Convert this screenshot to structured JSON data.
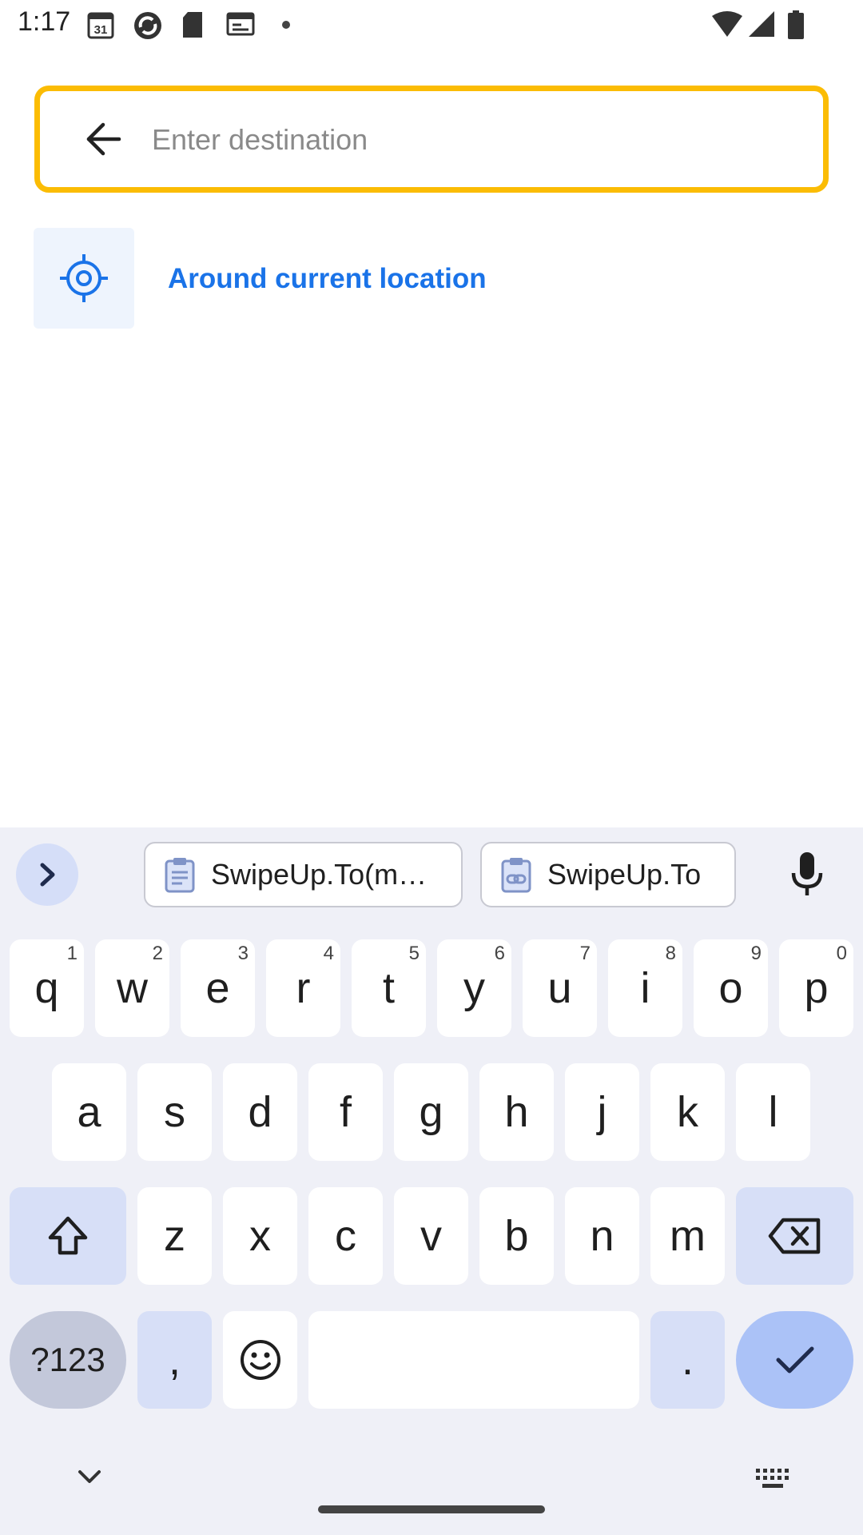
{
  "status_bar": {
    "time": "1:17",
    "icons": [
      "calendar-31-icon",
      "sync-icon",
      "sd-card-icon",
      "news-icon",
      "dot-icon",
      "wifi-icon",
      "signal-icon",
      "battery-icon"
    ],
    "calendar_day": "31"
  },
  "search": {
    "placeholder": "Enter destination",
    "value": "",
    "border_color": "#fbbc04"
  },
  "suggestions": [
    {
      "icon": "my-location-icon",
      "label": "Around current location",
      "color": "#1a73e8"
    }
  ],
  "keyboard": {
    "clipboard_chips": [
      {
        "icon": "clipboard-icon",
        "label": "SwipeUp.To(m…"
      },
      {
        "icon": "clipboard-link-icon",
        "label": "SwipeUp.To"
      }
    ],
    "row1": [
      {
        "k": "q",
        "h": "1"
      },
      {
        "k": "w",
        "h": "2"
      },
      {
        "k": "e",
        "h": "3"
      },
      {
        "k": "r",
        "h": "4"
      },
      {
        "k": "t",
        "h": "5"
      },
      {
        "k": "y",
        "h": "6"
      },
      {
        "k": "u",
        "h": "7"
      },
      {
        "k": "i",
        "h": "8"
      },
      {
        "k": "o",
        "h": "9"
      },
      {
        "k": "p",
        "h": "0"
      }
    ],
    "row2": [
      "a",
      "s",
      "d",
      "f",
      "g",
      "h",
      "j",
      "k",
      "l"
    ],
    "row3": [
      "z",
      "x",
      "c",
      "v",
      "b",
      "n",
      "m"
    ],
    "symbols_label": "?123",
    "comma": ",",
    "period": "."
  }
}
